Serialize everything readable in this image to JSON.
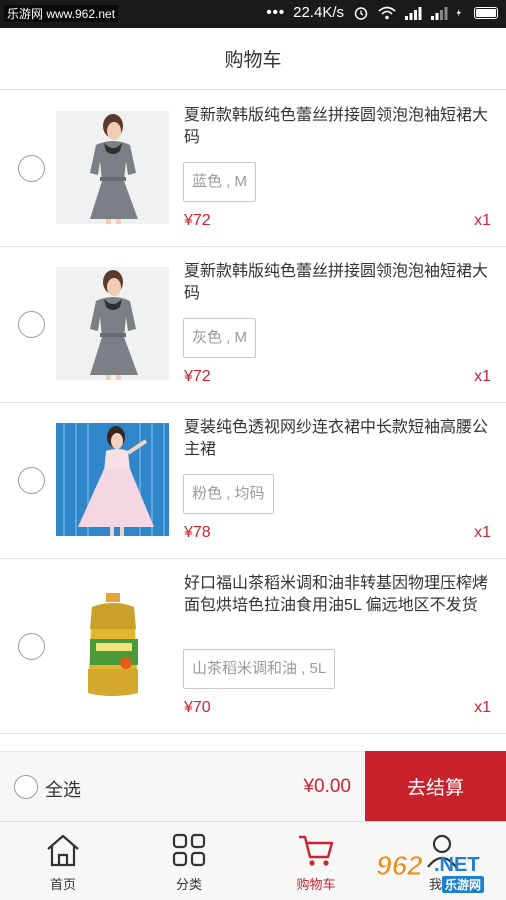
{
  "status_bar": {
    "watermark": "乐游网 www.962.net",
    "signal_dots": "•••",
    "net_speed": "22.4K/s"
  },
  "header": {
    "title": "购物车"
  },
  "cart_items": [
    {
      "name": "夏新款韩版纯色蕾丝拼接圆领泡泡袖短裙大码",
      "spec": "蓝色 , M",
      "price": "¥72",
      "qty": "x1",
      "image": "gray-lace-dress-photo"
    },
    {
      "name": "夏新款韩版纯色蕾丝拼接圆领泡泡袖短裙大码",
      "spec": "灰色 , M",
      "price": "¥72",
      "qty": "x1",
      "image": "gray-lace-dress-photo"
    },
    {
      "name": "夏装纯色透视网纱连衣裙中长款短袖高腰公主裙",
      "spec": "粉色 , 均码",
      "price": "¥78",
      "qty": "x1",
      "image": "pink-tulle-dress-photo"
    },
    {
      "name": "好口福山茶稻米调和油非转基因物理压榨烤面包烘培色拉油食用油5L 偏远地区不发货",
      "spec": "山茶稻米调和油 , 5L",
      "price": "¥70",
      "qty": "x1",
      "image": "cooking-oil-bottle-photo"
    }
  ],
  "checkout": {
    "select_all_label": "全选",
    "total": "¥0.00",
    "checkout_label": "去结算"
  },
  "tabs": [
    {
      "label": "首页",
      "icon": "home-icon",
      "active": false
    },
    {
      "label": "分类",
      "icon": "category-grid-icon",
      "active": false
    },
    {
      "label": "购物车",
      "icon": "cart-icon",
      "active": true
    },
    {
      "label": "我的",
      "icon": "user-icon",
      "active": false
    }
  ],
  "corner_logo": {
    "number": "962",
    "suffix": ".NET",
    "site": "乐游网"
  },
  "colors": {
    "accent": "#c8232c",
    "price": "#c7262f",
    "divider": "#e0e0e0",
    "tab_bg": "#f7f7f7"
  }
}
